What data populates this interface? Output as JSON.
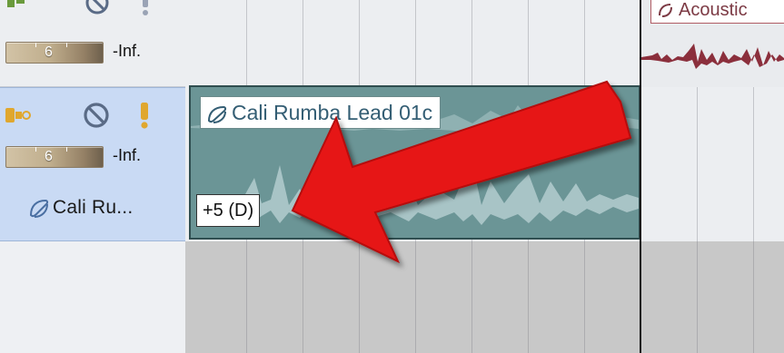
{
  "tracks": [
    {
      "fader_value": "6",
      "peak_label": "-Inf."
    },
    {
      "fader_value": "6",
      "peak_label": "-Inf.",
      "clip_name": "Cali Ru..."
    }
  ],
  "clips": {
    "main": {
      "title": "Cali Rumba Lead 01c",
      "pitch_label": "+5 (D)"
    },
    "top_right": {
      "title": "Acoustic"
    }
  },
  "colors": {
    "selected_track": "#c9daf4",
    "clip_main": "#6b9596",
    "clip_waveform": "#a8c4c6",
    "clip_top_right_waveform": "#8b2f3c",
    "arrow": "#e61414",
    "empty_lane": "#c8c8c8"
  },
  "icons": {
    "input_monitor": "input-monitor-icon",
    "disable": "no-entry-icon",
    "record_arm": "exclamation-icon",
    "loop": "loop-icon"
  }
}
